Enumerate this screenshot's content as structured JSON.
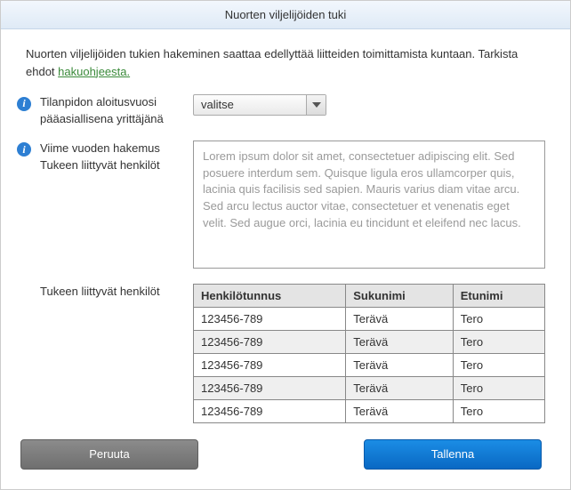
{
  "dialog": {
    "title": "Nuorten viljelijöiden tuki"
  },
  "intro": {
    "text_before": "Nuorten viljelijöiden tukien hakeminen saattaa edellyttää liitteiden toimittamista kuntaan. Tarkista ehdot ",
    "link_text": "hakuohjeesta."
  },
  "fields": {
    "start_year": {
      "label_line1": "Tilanpidon aloitusvuosi",
      "label_line2": "pääasiallisena yrittäjänä",
      "selected": "valitse"
    },
    "text_area": {
      "label_line1": "Viime vuoden hakemus",
      "label_line2": "Tukeen liittyvät henkilöt",
      "placeholder": "Lorem ipsum dolor sit amet, consectetuer adipiscing elit. Sed posuere interdum sem. Quisque ligula eros ullamcorper quis, lacinia quis facilisis sed sapien. Mauris varius diam vitae arcu. Sed arcu lectus auctor vitae, consectetuer et venenatis eget velit. Sed augue orci, lacinia eu tincidunt et eleifend nec lacus.",
      "value": ""
    }
  },
  "persons": {
    "section_label": "Tukeen liittyvät henkilöt",
    "columns": {
      "ssn": "Henkilötunnus",
      "last": "Sukunimi",
      "first": "Etunimi"
    },
    "rows": [
      {
        "ssn": "123456-789",
        "last": "Terävä",
        "first": "Tero"
      },
      {
        "ssn": "123456-789",
        "last": "Terävä",
        "first": "Tero"
      },
      {
        "ssn": "123456-789",
        "last": "Terävä",
        "first": "Tero"
      },
      {
        "ssn": "123456-789",
        "last": "Terävä",
        "first": "Tero"
      },
      {
        "ssn": "123456-789",
        "last": "Terävä",
        "first": "Tero"
      }
    ]
  },
  "buttons": {
    "cancel": "Peruuta",
    "save": "Tallenna"
  }
}
